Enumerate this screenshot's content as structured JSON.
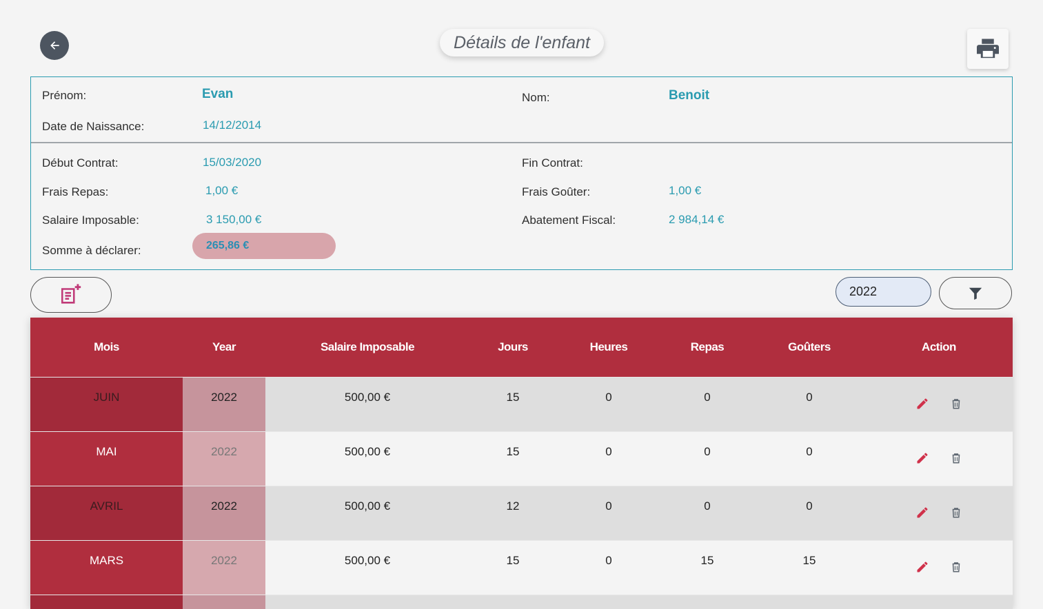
{
  "header": {
    "title": "Détails de l'enfant",
    "back_icon": "arrow-left-icon",
    "print_icon": "printer-icon"
  },
  "child": {
    "prenom_label": "Prénom:",
    "prenom": "Evan",
    "nom_label": "Nom:",
    "nom": "Benoit",
    "naissance_label": "Date de Naissance:",
    "naissance": "14/12/2014"
  },
  "contract": {
    "debut_label": "Début Contrat:",
    "debut": "15/03/2020",
    "fin_label": "Fin Contrat:",
    "fin": "",
    "frais_repas_label": "Frais Repas:",
    "frais_repas": "1,00 €",
    "frais_gouter_label": "Frais Goûter:",
    "frais_gouter": "1,00 €",
    "salaire_label": "Salaire Imposable:",
    "salaire": "3 150,00 €",
    "abattement_label": "Abatement Fiscal:",
    "abattement": "2 984,14 €",
    "somme_label": "Somme à déclarer:",
    "somme": "265,86 €"
  },
  "toolbar": {
    "add_icon": "add-note-icon",
    "year_value": "2022",
    "filter_icon": "filter-icon"
  },
  "table": {
    "columns": [
      "Mois",
      "Year",
      "Salaire Imposable",
      "Jours",
      "Heures",
      "Repas",
      "Goûters",
      "Action"
    ],
    "rows": [
      {
        "mois": "JUIN",
        "year": "2022",
        "salaire": "500,00 €",
        "jours": "15",
        "heures": "0",
        "repas": "0",
        "gouters": "0"
      },
      {
        "mois": "MAI",
        "year": "2022",
        "salaire": "500,00 €",
        "jours": "15",
        "heures": "0",
        "repas": "0",
        "gouters": "0"
      },
      {
        "mois": "AVRIL",
        "year": "2022",
        "salaire": "500,00 €",
        "jours": "12",
        "heures": "0",
        "repas": "0",
        "gouters": "0"
      },
      {
        "mois": "MARS",
        "year": "2022",
        "salaire": "500,00 €",
        "jours": "15",
        "heures": "0",
        "repas": "15",
        "gouters": "15"
      }
    ],
    "edit_icon": "pencil-icon",
    "delete_icon": "trash-icon"
  },
  "colors": {
    "accent": "#2a9bb0",
    "header_red": "#b02e3e",
    "edit_red": "#d0314a",
    "delete_gray": "#5d6670"
  }
}
